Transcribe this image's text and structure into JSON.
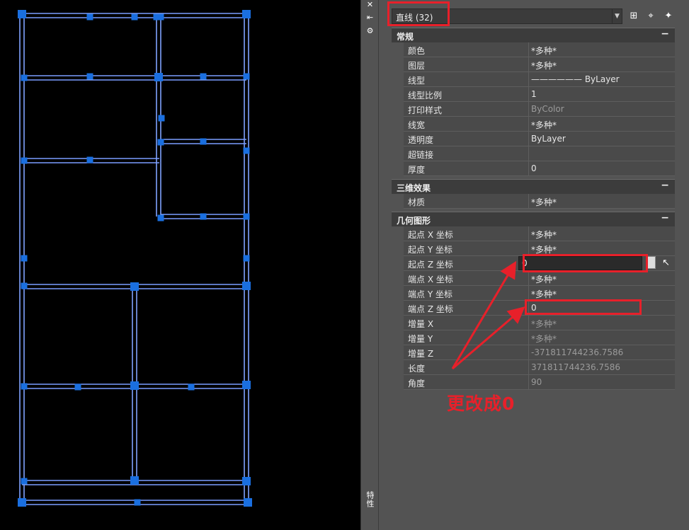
{
  "panel": {
    "selection_dropdown": {
      "value": "直线 (32)"
    },
    "toolbar_icons": [
      "quick-select-icon",
      "select-objects-icon",
      "toggle-pickadd-icon"
    ],
    "sections": {
      "general": {
        "title": "常规",
        "rows": [
          {
            "name": "颜色",
            "value": "*多种*"
          },
          {
            "name": "图层",
            "value": "*多种*"
          },
          {
            "name": "线型",
            "value": "——————  ByLayer"
          },
          {
            "name": "线型比例",
            "value": "1"
          },
          {
            "name": "打印样式",
            "value": "ByColor"
          },
          {
            "name": "线宽",
            "value": "*多种*"
          },
          {
            "name": "透明度",
            "value": "ByLayer"
          },
          {
            "name": "超链接",
            "value": ""
          },
          {
            "name": "厚度",
            "value": "0"
          }
        ]
      },
      "effects_3d": {
        "title": "三维效果",
        "rows": [
          {
            "name": "材质",
            "value": "*多种*"
          }
        ]
      },
      "geometry": {
        "title": "几何图形",
        "rows": [
          {
            "name": "起点 X 坐标",
            "value": "*多种*"
          },
          {
            "name": "起点 Y 坐标",
            "value": "*多种*"
          },
          {
            "name": "起点 Z 坐标",
            "value": "0"
          },
          {
            "name": "端点 X 坐标",
            "value": "*多种*"
          },
          {
            "name": "端点 Y 坐标",
            "value": "*多种*"
          },
          {
            "name": "端点 Z 坐标",
            "value": "0"
          },
          {
            "name": "增量 X",
            "value": "*多种*"
          },
          {
            "name": "增量 Y",
            "value": "*多种*"
          },
          {
            "name": "增量 Z",
            "value": "-371811744236.7586"
          },
          {
            "name": "长度",
            "value": "371811744236.7586"
          },
          {
            "name": "角度",
            "value": "90"
          }
        ]
      }
    },
    "collapse_symbol": "−"
  },
  "tool_strip": {
    "close_glyph": "✕",
    "autohide_glyph": "⇤",
    "settings_glyph": "⚙",
    "vertical_title": "特性"
  },
  "annotation": {
    "text": "更改成0",
    "color": "#e8202a"
  },
  "colors": {
    "drawing_line": "#4a7bff",
    "grip": "#1a6fe0",
    "highlight": "#e8202a"
  }
}
